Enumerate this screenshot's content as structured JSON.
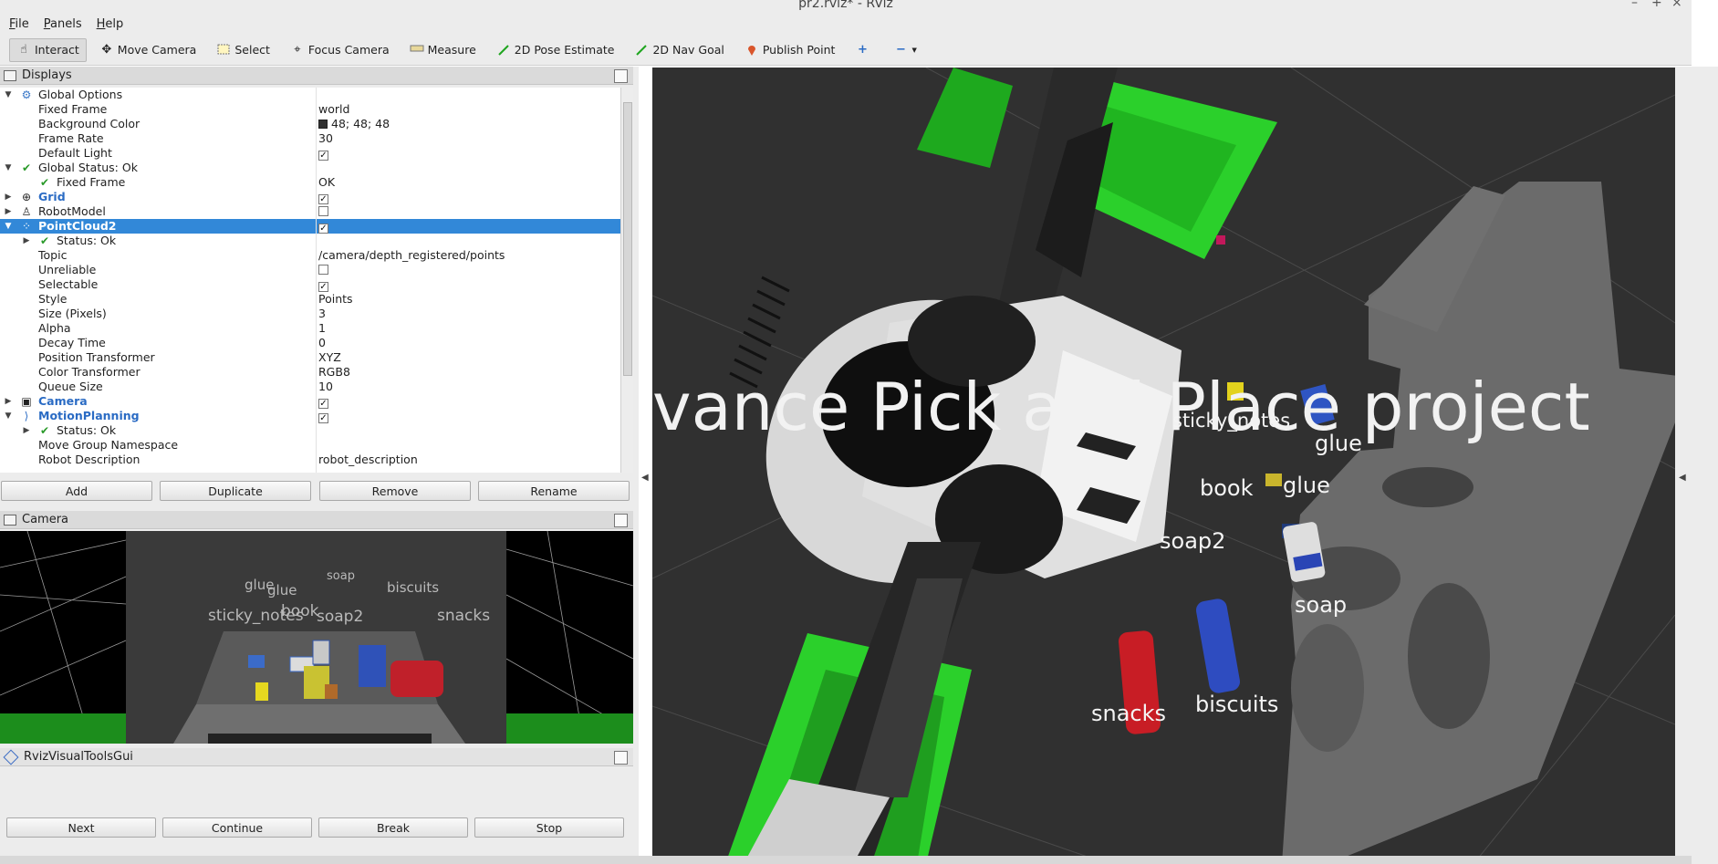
{
  "window": {
    "title": "pr2.rviz* - RViz",
    "minimize": "–",
    "maximize": "+",
    "close": "×"
  },
  "menu": [
    "File",
    "Panels",
    "Help"
  ],
  "toolbar": {
    "interact": "Interact",
    "move_camera": "Move Camera",
    "select": "Select",
    "focus_camera": "Focus Camera",
    "measure": "Measure",
    "pose_estimate": "2D Pose Estimate",
    "nav_goal": "2D Nav Goal",
    "publish_point": "Publish Point",
    "add_icon": "+",
    "remove_icon": "−"
  },
  "displays": {
    "title": "Displays",
    "rows": [
      {
        "name": "Global Options",
        "value": ""
      },
      {
        "name": "Fixed Frame",
        "value": "world"
      },
      {
        "name": "Background Color",
        "value": "48; 48; 48"
      },
      {
        "name": "Frame Rate",
        "value": "30"
      },
      {
        "name": "Default Light",
        "value": ""
      },
      {
        "name": "Global Status: Ok",
        "value": ""
      },
      {
        "name": "Fixed Frame",
        "value": "OK"
      },
      {
        "name": "Grid",
        "value": ""
      },
      {
        "name": "RobotModel",
        "value": ""
      },
      {
        "name": "PointCloud2",
        "value": ""
      },
      {
        "name": "Status: Ok",
        "value": ""
      },
      {
        "name": "Topic",
        "value": "/camera/depth_registered/points"
      },
      {
        "name": "Unreliable",
        "value": ""
      },
      {
        "name": "Selectable",
        "value": ""
      },
      {
        "name": "Style",
        "value": "Points"
      },
      {
        "name": "Size (Pixels)",
        "value": "3"
      },
      {
        "name": "Alpha",
        "value": "1"
      },
      {
        "name": "Decay Time",
        "value": "0"
      },
      {
        "name": "Position Transformer",
        "value": "XYZ"
      },
      {
        "name": "Color Transformer",
        "value": "RGB8"
      },
      {
        "name": "Queue Size",
        "value": "10"
      },
      {
        "name": "Camera",
        "value": ""
      },
      {
        "name": "MotionPlanning",
        "value": ""
      },
      {
        "name": "Status: Ok",
        "value": ""
      },
      {
        "name": "Move Group Namespace",
        "value": ""
      },
      {
        "name": "Robot Description",
        "value": "robot_description"
      }
    ],
    "buttons": {
      "add": "Add",
      "duplicate": "Duplicate",
      "remove": "Remove",
      "rename": "Rename"
    }
  },
  "camera_panel": {
    "title": "Camera",
    "labels": [
      "glue",
      "glue",
      "soap",
      "biscuits",
      "sticky_notes",
      "book",
      "soap2",
      "snacks"
    ]
  },
  "rviz_visual_tools": {
    "title": "RvizVisualToolsGui",
    "buttons": {
      "next": "Next",
      "continue": "Continue",
      "break": "Break",
      "stop": "Stop"
    }
  },
  "viewport": {
    "banner": "vance Pick and Place project",
    "labels": [
      "sticky_notes",
      "glue",
      "book",
      "glue",
      "soap2",
      "soap",
      "biscuits",
      "snacks"
    ]
  },
  "colors": {
    "background": "#303030",
    "selection": "#3288d8",
    "bin_green": "#22cc22"
  }
}
